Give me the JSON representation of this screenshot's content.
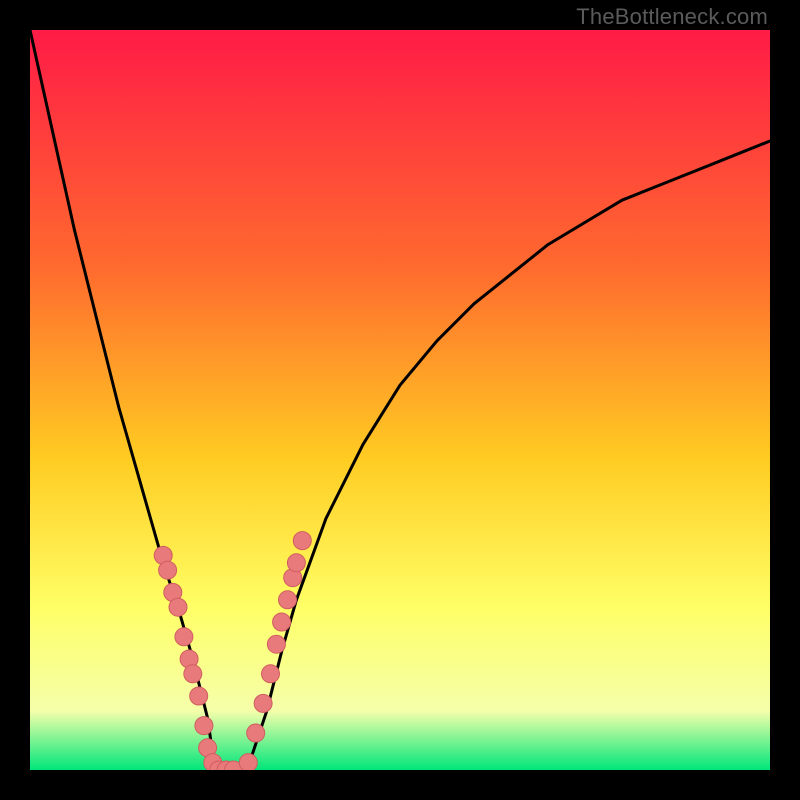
{
  "watermark": "TheBottleneck.com",
  "colors": {
    "background": "#000000",
    "grad_top": "#ff1b47",
    "grad_mid1": "#ff6a2e",
    "grad_mid2": "#ffcc22",
    "grad_mid3": "#ffff66",
    "grad_mid4": "#f5ffaa",
    "grad_bottom": "#00e67a",
    "curve": "#000000",
    "marker_fill": "#e97a7c",
    "marker_stroke": "#d05d60"
  },
  "chart_data": {
    "type": "line",
    "title": "",
    "xlabel": "",
    "ylabel": "",
    "xlim": [
      0,
      100
    ],
    "ylim": [
      0,
      100
    ],
    "series": [
      {
        "name": "bottleneck-curve",
        "x": [
          0,
          2,
          4,
          6,
          8,
          10,
          12,
          14,
          16,
          18,
          20,
          22,
          24,
          25,
          26,
          28,
          30,
          32,
          34,
          36,
          40,
          45,
          50,
          55,
          60,
          65,
          70,
          75,
          80,
          85,
          90,
          95,
          100
        ],
        "y": [
          100,
          91,
          82,
          73,
          65,
          57,
          49,
          42,
          35,
          28,
          22,
          15,
          7,
          0,
          0,
          0,
          2,
          8,
          16,
          23,
          34,
          44,
          52,
          58,
          63,
          67,
          71,
          74,
          77,
          79,
          81,
          83,
          85
        ]
      }
    ],
    "scatter": [
      {
        "name": "left-branch-markers",
        "points": [
          {
            "x": 18.0,
            "y": 29
          },
          {
            "x": 18.6,
            "y": 27
          },
          {
            "x": 19.3,
            "y": 24
          },
          {
            "x": 20.0,
            "y": 22
          },
          {
            "x": 20.8,
            "y": 18
          },
          {
            "x": 21.5,
            "y": 15
          },
          {
            "x": 22.0,
            "y": 13
          },
          {
            "x": 22.8,
            "y": 10
          },
          {
            "x": 23.5,
            "y": 6
          },
          {
            "x": 24.0,
            "y": 3
          },
          {
            "x": 24.7,
            "y": 1
          },
          {
            "x": 25.5,
            "y": 0
          },
          {
            "x": 26.5,
            "y": 0
          },
          {
            "x": 27.5,
            "y": 0
          }
        ]
      },
      {
        "name": "right-branch-markers",
        "points": [
          {
            "x": 29.5,
            "y": 1
          },
          {
            "x": 30.5,
            "y": 5
          },
          {
            "x": 31.5,
            "y": 9
          },
          {
            "x": 32.5,
            "y": 13
          },
          {
            "x": 33.3,
            "y": 17
          },
          {
            "x": 34.0,
            "y": 20
          },
          {
            "x": 34.8,
            "y": 23
          },
          {
            "x": 35.5,
            "y": 26
          },
          {
            "x": 36.0,
            "y": 28
          },
          {
            "x": 36.8,
            "y": 31
          }
        ]
      }
    ]
  }
}
